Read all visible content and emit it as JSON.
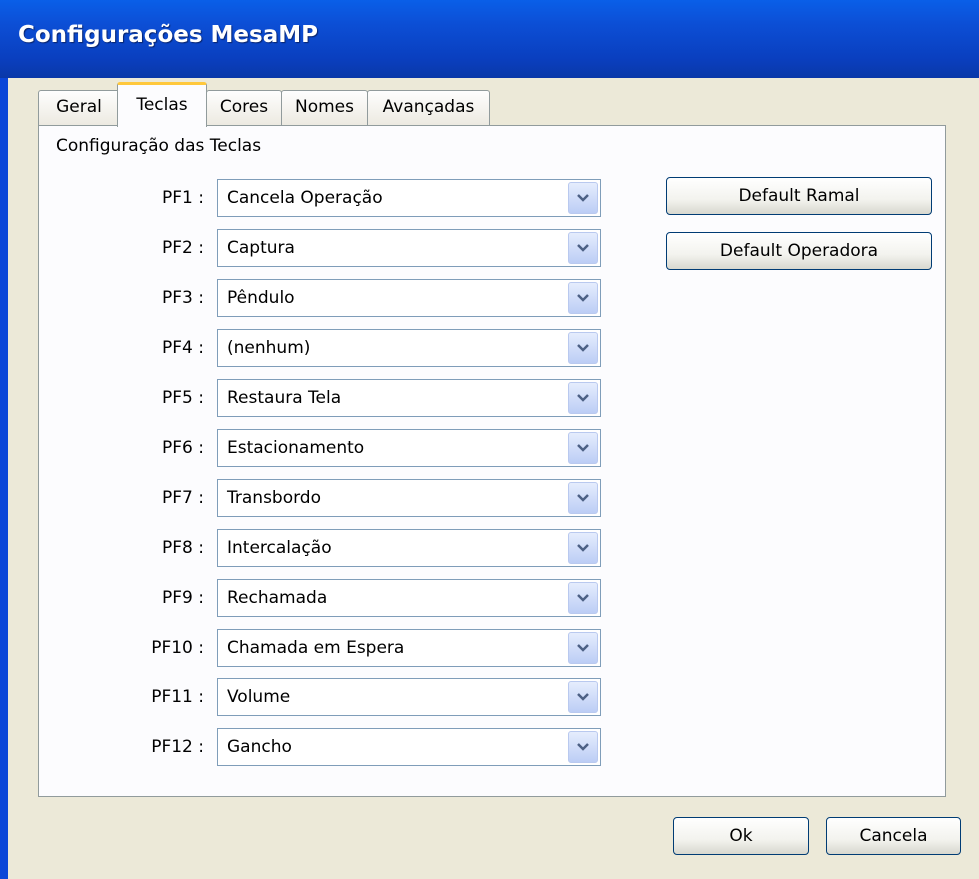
{
  "window": {
    "title": "Configurações MesaMP"
  },
  "tabs": [
    {
      "label": "Geral",
      "active": false
    },
    {
      "label": "Teclas",
      "active": true
    },
    {
      "label": "Cores",
      "active": false
    },
    {
      "label": "Nomes",
      "active": false
    },
    {
      "label": "Avançadas",
      "active": false
    }
  ],
  "panel": {
    "group_label": "Configuração das Teclas",
    "keys": [
      {
        "label": "PF1 :",
        "value": "Cancela Operação"
      },
      {
        "label": "PF2 :",
        "value": "Captura"
      },
      {
        "label": "PF3 :",
        "value": "Pêndulo"
      },
      {
        "label": "PF4 :",
        "value": "(nenhum)"
      },
      {
        "label": "PF5 :",
        "value": "Restaura Tela"
      },
      {
        "label": "PF6 :",
        "value": "Estacionamento"
      },
      {
        "label": "PF7 :",
        "value": "Transbordo"
      },
      {
        "label": "PF8 :",
        "value": "Intercalação"
      },
      {
        "label": "PF9 :",
        "value": "Rechamada"
      },
      {
        "label": "PF10 :",
        "value": "Chamada em Espera"
      },
      {
        "label": "PF11 :",
        "value": "Volume"
      },
      {
        "label": "PF12 :",
        "value": "Gancho"
      }
    ],
    "default_ramal_label": "Default Ramal",
    "default_operadora_label": "Default Operadora"
  },
  "footer": {
    "ok_label": "Ok",
    "cancel_label": "Cancela"
  },
  "colors": {
    "titlebar": "#0a4fd6",
    "tab_highlight": "#ffc83c",
    "window_bg": "#ece9d8"
  }
}
